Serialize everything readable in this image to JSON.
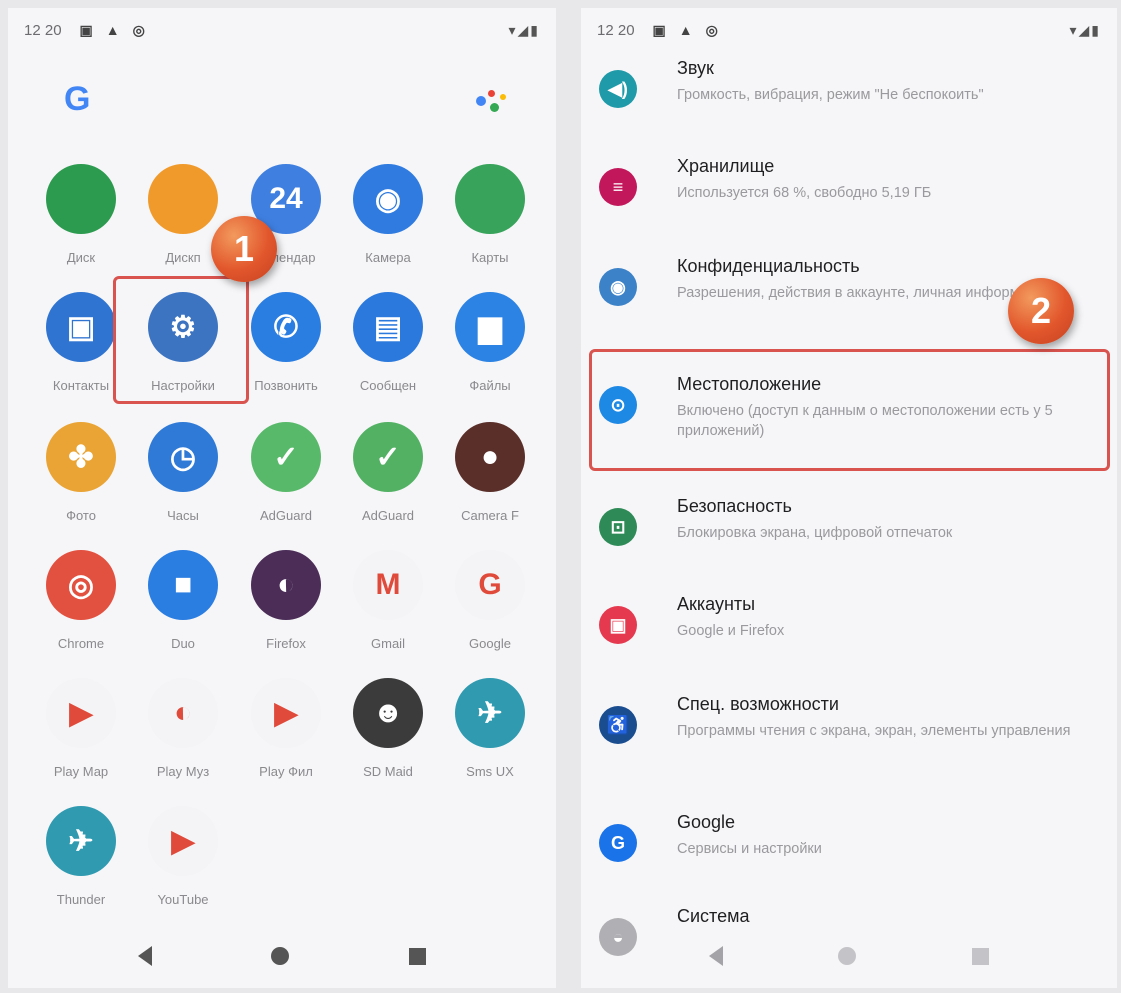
{
  "status": {
    "time": "12 20",
    "icons_right": "▾◢▮"
  },
  "launcher": {
    "apps": [
      {
        "label": "Диск",
        "icon": "drive-icon",
        "glyph": "",
        "color": "#2d9b4f"
      },
      {
        "label": "Дискп",
        "icon": "disk-app-icon",
        "glyph": "",
        "color": "#f19a2c"
      },
      {
        "label": "Календар",
        "icon": "calendar-icon",
        "glyph": "24",
        "color": "#3f7fe0"
      },
      {
        "label": "Камера",
        "icon": "camera-icon",
        "glyph": "◉",
        "color": "#2f7be0"
      },
      {
        "label": "Карты",
        "icon": "maps-icon",
        "glyph": "",
        "color": "#37a35b"
      },
      {
        "label": "Контакты",
        "icon": "contacts-icon",
        "glyph": "▣",
        "color": "#2f74d0"
      },
      {
        "label": "Настройки",
        "icon": "gear-icon",
        "glyph": "⚙",
        "color": "#3c74c2"
      },
      {
        "label": "Позвонить",
        "icon": "phone-icon",
        "glyph": "✆",
        "color": "#2a7de1"
      },
      {
        "label": "Сообщен",
        "icon": "messages-icon",
        "glyph": "▤",
        "color": "#2b79dd"
      },
      {
        "label": "Файлы",
        "icon": "files-icon",
        "glyph": "▆",
        "color": "#2c83e3"
      },
      {
        "label": "Фото",
        "icon": "photos-icon",
        "glyph": "✤",
        "color": "#e9a435"
      },
      {
        "label": "Часы",
        "icon": "clock-icon",
        "glyph": "◷",
        "color": "#2f7ad6"
      },
      {
        "label": "AdGuard",
        "icon": "adguard-icon",
        "glyph": "✓",
        "color": "#59b96a"
      },
      {
        "label": "AdGuard",
        "icon": "adguard-shield-icon",
        "glyph": "✓",
        "color": "#53b164"
      },
      {
        "label": "Camera F",
        "icon": "camera-fv-icon",
        "glyph": "●",
        "color": "#5a2f2a"
      },
      {
        "label": "Chrome",
        "icon": "chrome-icon",
        "glyph": "◎",
        "color": "#e25040"
      },
      {
        "label": "Duo",
        "icon": "duo-icon",
        "glyph": "■",
        "color": "#2a7de1"
      },
      {
        "label": "Firefox",
        "icon": "firefox-icon",
        "glyph": "◐",
        "color": "#4b2d57"
      },
      {
        "label": "Gmail",
        "icon": "gmail-icon",
        "glyph": "M",
        "color": "#f4f4f6"
      },
      {
        "label": "Google",
        "icon": "google-icon",
        "glyph": "G",
        "color": "#f4f4f6"
      },
      {
        "label": "Play Мар",
        "icon": "play-market-icon",
        "glyph": "▶",
        "color": "#f4f4f6"
      },
      {
        "label": "Play Муз",
        "icon": "play-music-icon",
        "glyph": "◐",
        "color": "#f4f4f6"
      },
      {
        "label": "Play Фил",
        "icon": "play-movies-icon",
        "glyph": "▶",
        "color": "#f4f4f6"
      },
      {
        "label": "SD Maid",
        "icon": "sd-maid-icon",
        "glyph": "☻",
        "color": "#3b3b3b"
      },
      {
        "label": "Sms UX",
        "icon": "sms-ux-icon",
        "glyph": "✈",
        "color": "#2f9ab0"
      },
      {
        "label": "Thunder",
        "icon": "thunder-icon",
        "glyph": "✈",
        "color": "#2f9ab0"
      },
      {
        "label": "YouTube",
        "icon": "youtube-icon",
        "glyph": "▶",
        "color": "#f4f4f6"
      }
    ]
  },
  "badges": {
    "step1": "1",
    "step2": "2"
  },
  "settings": {
    "items": [
      {
        "title": "Звук",
        "sub": "Громкость, вибрация, режим \"Не беспокоить\"",
        "icon": "sound-icon",
        "glyph": "◀)",
        "color": "#1e9aa8"
      },
      {
        "title": "Хранилище",
        "sub": "Используется 68 %, свободно 5,19 ГБ",
        "icon": "storage-icon",
        "glyph": "≡",
        "color": "#c2185b"
      },
      {
        "title": "Конфиденциальность",
        "sub": "Разрешения, действия в аккаунте, личная информация",
        "icon": "privacy-icon",
        "glyph": "◉",
        "color": "#3c82c8"
      },
      {
        "title": "Местоположение",
        "sub": "Включено (доступ к данным о местоположении есть у 5 приложений)",
        "icon": "location-icon",
        "glyph": "⊙",
        "color": "#1e88e5"
      },
      {
        "title": "Безопасность",
        "sub": "Блокировка экрана, цифровой отпечаток",
        "icon": "lock-icon",
        "glyph": "⊡",
        "color": "#2e8b57"
      },
      {
        "title": "Аккаунты",
        "sub": "Google и Firefox",
        "icon": "accounts-icon",
        "glyph": "▣",
        "color": "#e53950"
      },
      {
        "title": "Спец. возможности",
        "sub": "Программы чтения с экрана, экран, элементы управления",
        "icon": "accessibility-icon",
        "glyph": "♿",
        "color": "#1a4d8f"
      },
      {
        "title": "Google",
        "sub": "Сервисы и настройки",
        "icon": "google-settings-icon",
        "glyph": "G",
        "color": "#1a73e8"
      },
      {
        "title": "Система",
        "sub": "",
        "icon": "system-icon",
        "glyph": "◒",
        "color": "#b0b0b4"
      }
    ]
  }
}
